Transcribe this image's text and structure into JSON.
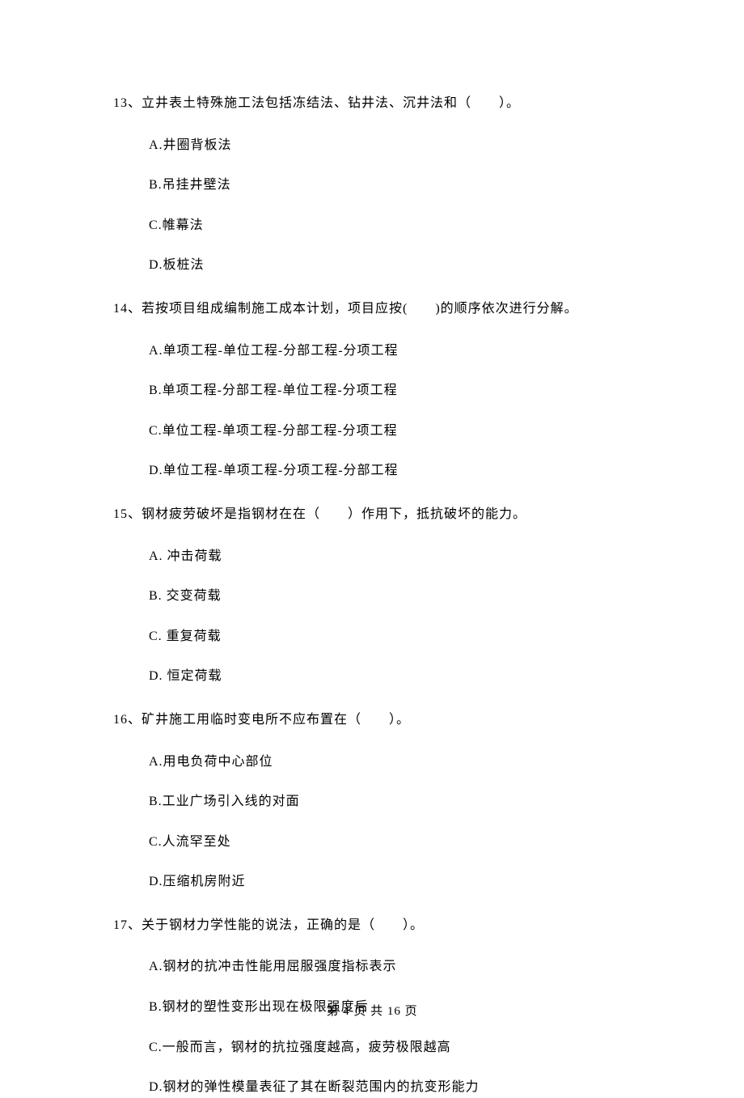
{
  "questions": [
    {
      "number": "13、",
      "text": "立井表土特殊施工法包括冻结法、钻井法、沉井法和（　　）。",
      "options": [
        "A.井圈背板法",
        "B.吊挂井壁法",
        "C.帷幕法",
        "D.板桩法"
      ]
    },
    {
      "number": "14、",
      "text": "若按项目组成编制施工成本计划，项目应按(　　)的顺序依次进行分解。",
      "options": [
        "A.单项工程-单位工程-分部工程-分项工程",
        "B.单项工程-分部工程-单位工程-分项工程",
        "C.单位工程-单项工程-分部工程-分项工程",
        "D.单位工程-单项工程-分项工程-分部工程"
      ]
    },
    {
      "number": "15、",
      "text": "钢材疲劳破坏是指钢材在在（　　）作用下，抵抗破坏的能力。",
      "options": [
        "A. 冲击荷载",
        "B. 交变荷载",
        "C. 重复荷载",
        "D. 恒定荷载"
      ]
    },
    {
      "number": "16、",
      "text": "矿井施工用临时变电所不应布置在（　　）。",
      "options": [
        "A.用电负荷中心部位",
        "B.工业广场引入线的对面",
        "C.人流罕至处",
        "D.压缩机房附近"
      ]
    },
    {
      "number": "17、",
      "text": "关于钢材力学性能的说法，正确的是（　　）。",
      "options": [
        "A.钢材的抗冲击性能用屈服强度指标表示",
        "B.钢材的塑性变形出现在极限强度后",
        "C.一般而言，钢材的抗拉强度越高，疲劳极限越高",
        "D.钢材的弹性模量表征了其在断裂范围内的抗变形能力"
      ]
    }
  ],
  "footer": "第 4 页 共 16 页"
}
